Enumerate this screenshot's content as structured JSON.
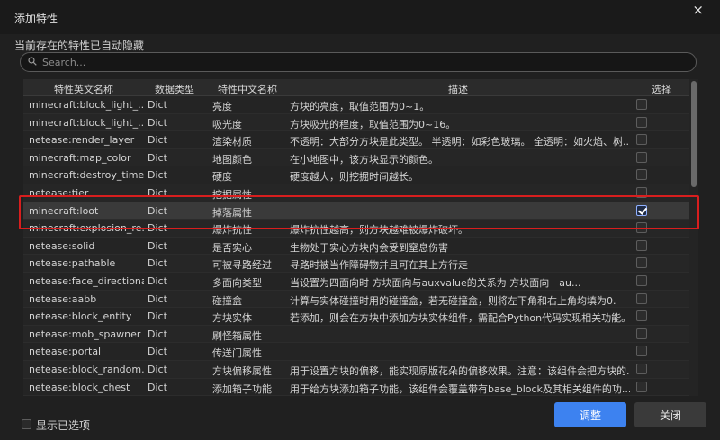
{
  "dialog": {
    "title": "添加特性",
    "close_glyph": "×",
    "subtitle": "当前存在的特性已自动隐藏"
  },
  "search": {
    "placeholder": "Search...",
    "value": ""
  },
  "table": {
    "headers": {
      "name": "特性英文名称",
      "type": "数据类型",
      "cn_name": "特性中文名称",
      "desc": "描述",
      "select": "选择"
    },
    "rows": [
      {
        "name": "minecraft:block_light_...",
        "type": "Dict",
        "cn": "亮度",
        "desc": "方块的亮度，取值范围为0~1。",
        "checked": false
      },
      {
        "name": "minecraft:block_light_...",
        "type": "Dict",
        "cn": "吸光度",
        "desc": "方块吸光的程度，取值范围为0~16。",
        "checked": false
      },
      {
        "name": "netease:render_layer",
        "type": "Dict",
        "cn": "渲染材质",
        "desc": "不透明：大部分方块是此类型。 半透明：如彩色玻璃。 全透明：如火焰、树...",
        "checked": false
      },
      {
        "name": "minecraft:map_color",
        "type": "Dict",
        "cn": "地图颜色",
        "desc": "在小地图中，该方块显示的颜色。",
        "checked": false
      },
      {
        "name": "minecraft:destroy_time",
        "type": "Dict",
        "cn": "硬度",
        "desc": "硬度越大，则挖掘时间越长。",
        "checked": false
      },
      {
        "name": "netease:tier",
        "type": "Dict",
        "cn": "挖掘属性",
        "desc": "",
        "checked": false
      },
      {
        "name": "minecraft:loot",
        "type": "Dict",
        "cn": "掉落属性",
        "desc": "",
        "checked": true
      },
      {
        "name": "minecraft:explosion_re...",
        "type": "Dict",
        "cn": "爆炸抗性",
        "desc": "爆炸抗性越高，则方块越难被爆炸破坏。",
        "checked": false
      },
      {
        "name": "netease:solid",
        "type": "Dict",
        "cn": "是否实心",
        "desc": "生物处于实心方块内会受到窒息伤害",
        "checked": false
      },
      {
        "name": "netease:pathable",
        "type": "Dict",
        "cn": "可被寻路经过",
        "desc": "寻路时被当作障碍物并且可在其上方行走",
        "checked": false
      },
      {
        "name": "netease:face_directional",
        "type": "Dict",
        "cn": "多面向类型",
        "desc": "当设置为四面向时 方块面向与auxvalue的关系为 方块面向　au...",
        "checked": false
      },
      {
        "name": "netease:aabb",
        "type": "Dict",
        "cn": "碰撞盒",
        "desc": "计算与实体碰撞时用的碰撞盒，若无碰撞盒，则将左下角和右上角均填为0.",
        "checked": false
      },
      {
        "name": "netease:block_entity",
        "type": "Dict",
        "cn": "方块实体",
        "desc": "若添加，则会在方块中添加方块实体组件，需配合Python代码实现相关功能。",
        "checked": false
      },
      {
        "name": "netease:mob_spawner",
        "type": "Dict",
        "cn": "刷怪箱属性",
        "desc": "",
        "checked": false
      },
      {
        "name": "netease:portal",
        "type": "Dict",
        "cn": "传送门属性",
        "desc": "",
        "checked": false
      },
      {
        "name": "netease:block_random...",
        "type": "Dict",
        "cn": "方块偏移属性",
        "desc": "用于设置方块的偏移，能实现原版花朵的偏移效果。注意：该组件会把方块的...",
        "checked": false
      },
      {
        "name": "netease:block_chest",
        "type": "Dict",
        "cn": "添加箱子功能",
        "desc": "用于给方块添加箱子功能，该组件会覆盖带有base_block及其相关组件的功...",
        "checked": false
      }
    ]
  },
  "footer": {
    "show_selected_label": "显示已选项",
    "adjust_button": "调整",
    "close_button": "关闭"
  },
  "colors": {
    "accent": "#3d82f0",
    "highlight": "#d81e1e",
    "background": "#202020"
  }
}
